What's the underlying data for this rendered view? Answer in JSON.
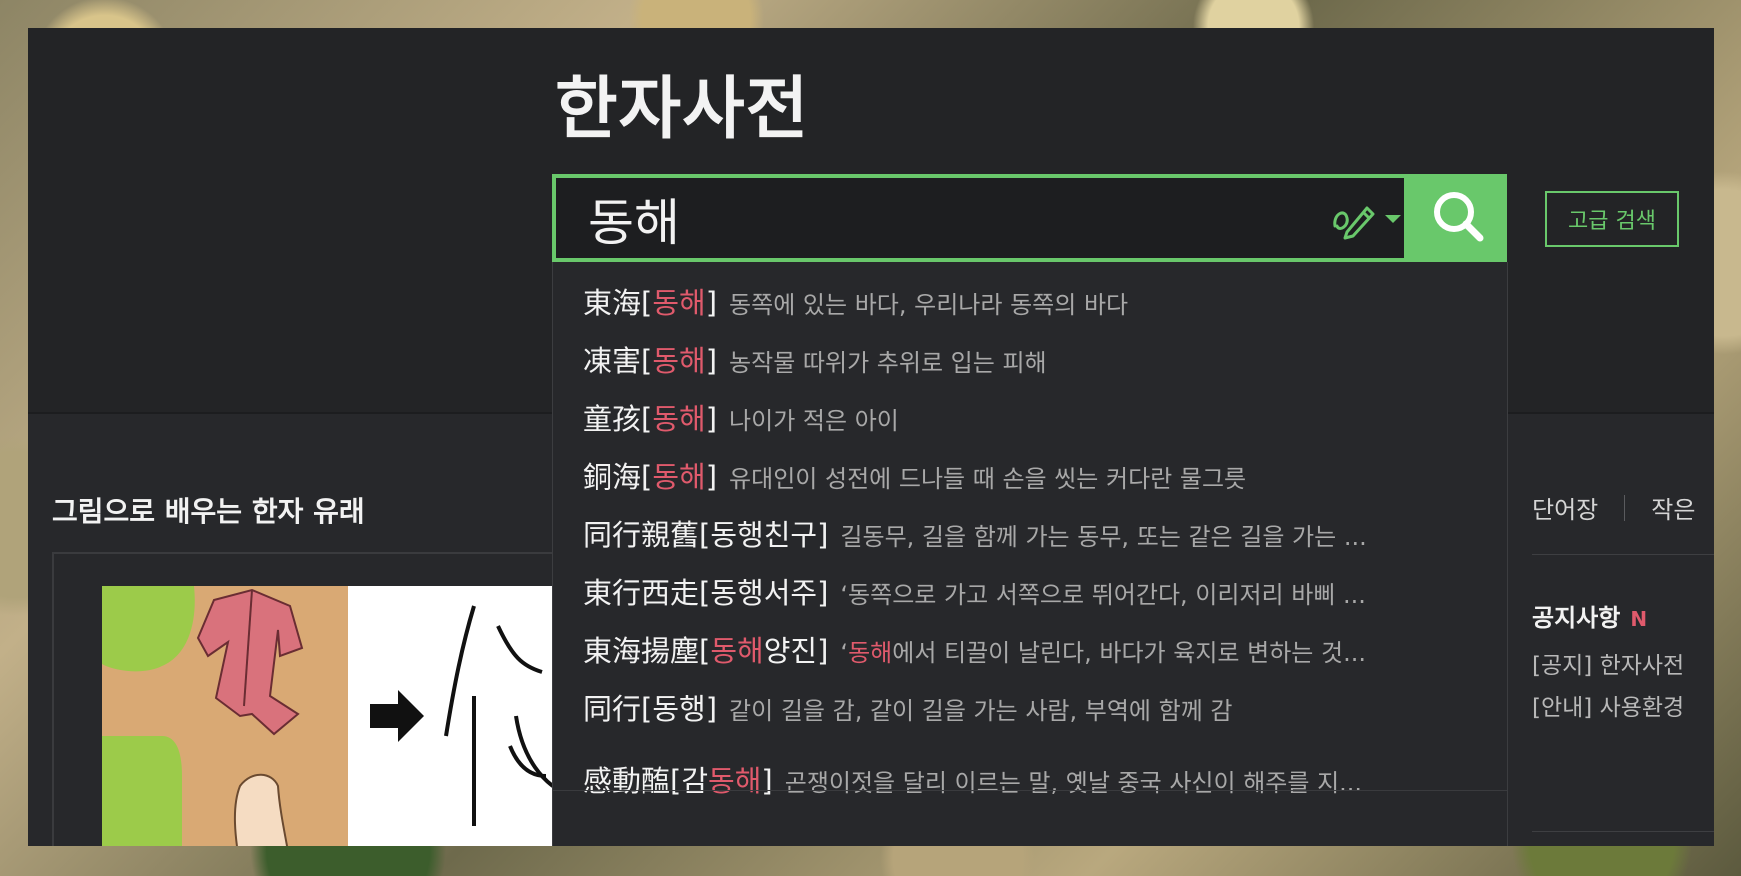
{
  "site": {
    "logo": "한자사전"
  },
  "search": {
    "query": "동해",
    "handwrite_icon": "pencil-icon",
    "search_icon": "magnifier-icon",
    "advanced_label": "고급 검색",
    "accent_color": "#69c86b",
    "highlight_color": "#e05a6c"
  },
  "suggestions": [
    {
      "hanja": "東海",
      "pre": "",
      "hl": "동해",
      "post": "",
      "desc_pre": "",
      "desc_hl": "",
      "desc": "동쪽에 있는 바다, 우리나라 동쪽의 바다"
    },
    {
      "hanja": "凍害",
      "pre": "",
      "hl": "동해",
      "post": "",
      "desc_pre": "",
      "desc_hl": "",
      "desc": "농작물 따위가 추위로 입는 피해"
    },
    {
      "hanja": "童孩",
      "pre": "",
      "hl": "동해",
      "post": "",
      "desc_pre": "",
      "desc_hl": "",
      "desc": "나이가 적은 아이"
    },
    {
      "hanja": "銅海",
      "pre": "",
      "hl": "동해",
      "post": "",
      "desc_pre": "",
      "desc_hl": "",
      "desc": "유대인이 성전에 드나들 때 손을 씻는 커다란 물그릇"
    },
    {
      "hanja": "同行親舊",
      "pre": "동행친구",
      "hl": "",
      "post": "",
      "desc_pre": "",
      "desc_hl": "",
      "desc": "길동무, 길을 함께 가는 동무, 또는 같은 길을 가는 ..."
    },
    {
      "hanja": "東行西走",
      "pre": "동행서주",
      "hl": "",
      "post": "",
      "desc_pre": "",
      "desc_hl": "",
      "desc": "‘동쪽으로 가고 서쪽으로 뛰어간다, 이리저리 바삐 ..."
    },
    {
      "hanja": "東海揚塵",
      "pre": "",
      "hl": "동해",
      "post": "양진",
      "desc_pre": "‘",
      "desc_hl": "동해",
      "desc": "에서 티끌이 날린다, 바다가 육지로 변하는 것..."
    },
    {
      "hanja": "同行",
      "pre": "동행",
      "hl": "",
      "post": "",
      "desc_pre": "",
      "desc_hl": "",
      "desc": "같이 길을 감, 같이 길을 가는 사람, 부역에 함께 감"
    },
    {
      "hanja": "感動醢",
      "pre": "감",
      "hl": "동해",
      "post": "",
      "desc_pre": "",
      "desc_hl": "",
      "desc": "곤쟁이젓을 달리 이르는 말, 옛날 중국 사신이 해주를 지..."
    }
  ],
  "main": {
    "section_title": "그림으로 배우는 한자 유래"
  },
  "sidebar": {
    "tabs": [
      "단어장",
      "작은"
    ],
    "notice_title": "공지사항",
    "notice_badge": "N",
    "notices": [
      "[공지] 한자사전",
      "[안내] 사용환경"
    ]
  }
}
